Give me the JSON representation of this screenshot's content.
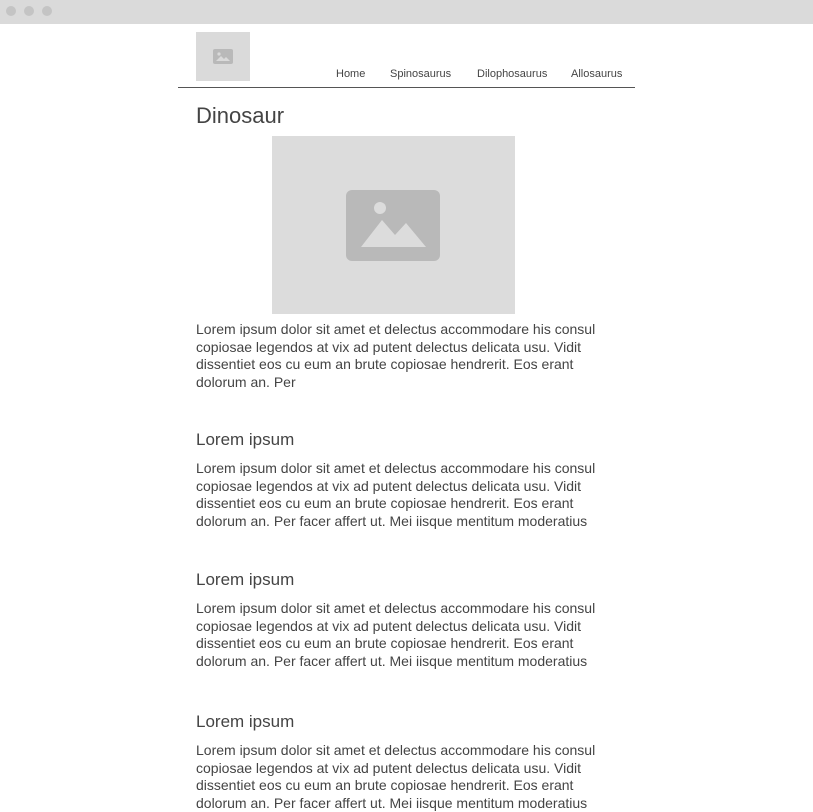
{
  "nav": {
    "items": [
      {
        "label": "Home"
      },
      {
        "label": "Spinosaurus"
      },
      {
        "label": "Dilophosaurus"
      },
      {
        "label": "Allosaurus"
      }
    ]
  },
  "main": {
    "title": "Dinosaur",
    "intro": "Lorem ipsum dolor sit amet et delectus accommodare his consul copiosae legendos at vix ad putent delectus delicata usu. Vidit dissentiet eos cu eum an brute copiosae hendrerit. Eos erant dolorum an. Per",
    "sections": [
      {
        "heading": "Lorem ipsum",
        "body": "Lorem ipsum dolor sit amet et delectus accommodare his consul copiosae legendos at vix ad putent delectus delicata usu. Vidit dissentiet eos cu eum an brute copiosae hendrerit. Eos erant dolorum an. Per facer affert ut. Mei iisque mentitum moderatius"
      },
      {
        "heading": "Lorem ipsum",
        "body": "Lorem ipsum dolor sit amet et delectus accommodare his consul copiosae legendos at vix ad putent delectus delicata usu. Vidit dissentiet eos cu eum an brute copiosae hendrerit. Eos erant dolorum an. Per facer affert ut. Mei iisque mentitum moderatius"
      },
      {
        "heading": "Lorem ipsum",
        "body": "Lorem ipsum dolor sit amet et delectus accommodare his consul copiosae legendos at vix ad putent delectus delicata usu. Vidit dissentiet eos cu eum an brute copiosae hendrerit. Eos erant dolorum an. Per facer affert ut. Mei iisque mentitum moderatius"
      }
    ]
  },
  "icons": {
    "logo": "image-placeholder-icon",
    "hero": "image-placeholder-icon"
  },
  "colors": {
    "placeholder": "#dcdcdc",
    "placeholder_icon": "#b9b9b9",
    "text": "#444444",
    "titlebar": "#dadada"
  }
}
